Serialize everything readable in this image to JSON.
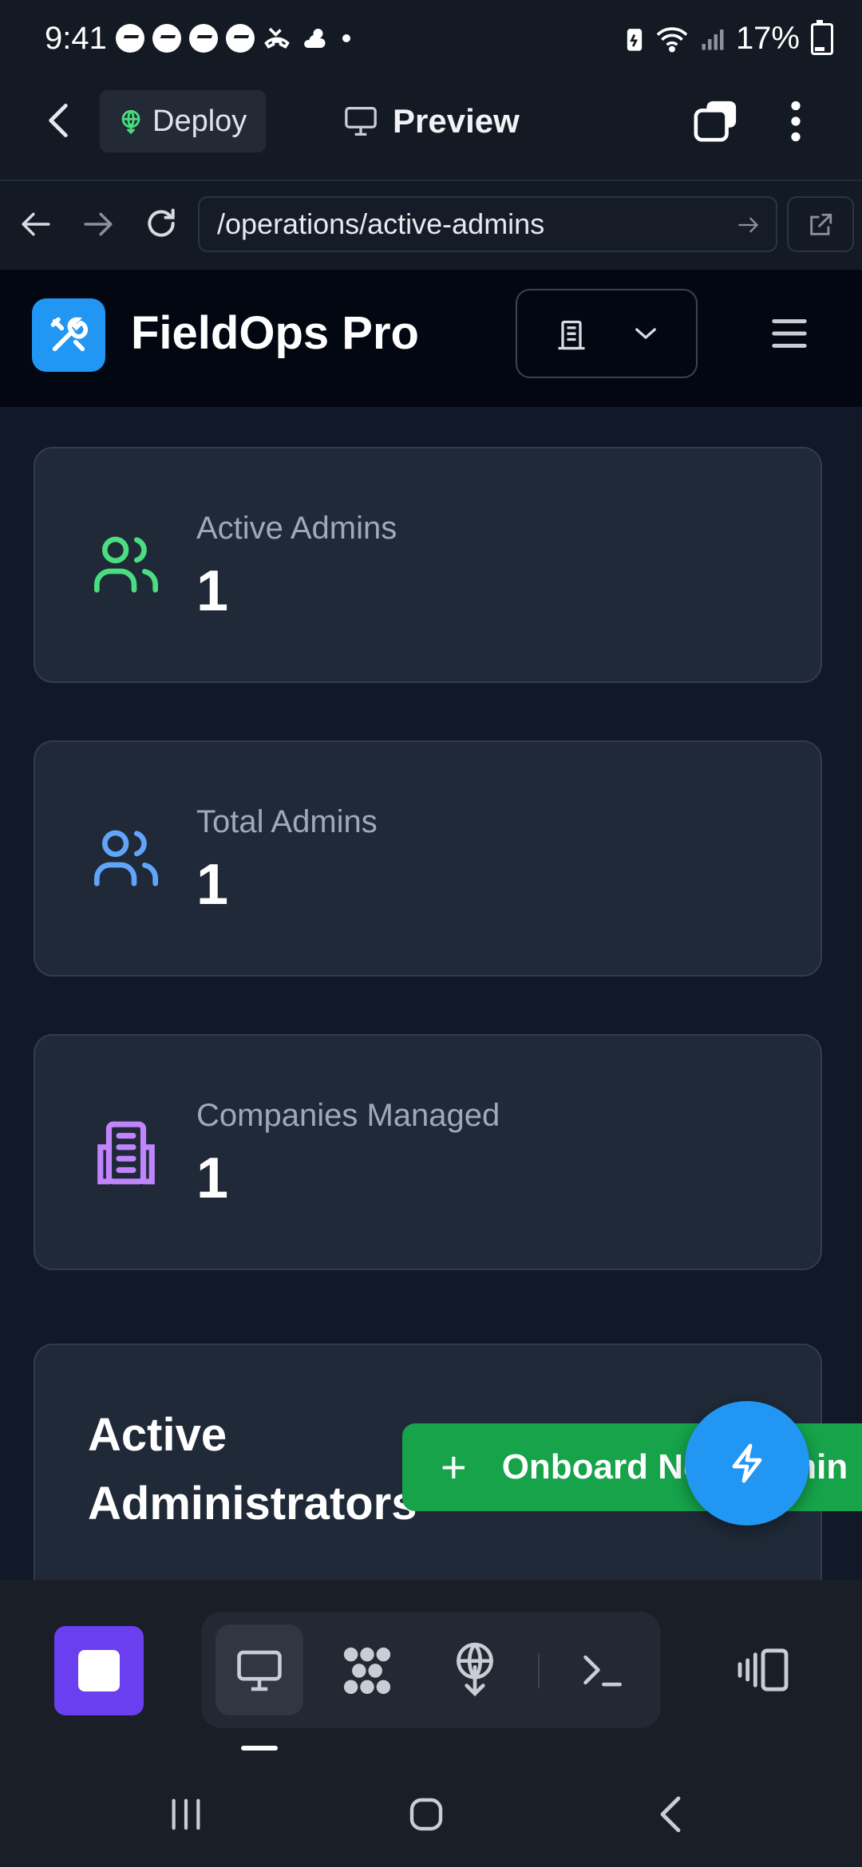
{
  "status_bar": {
    "time": "9:41",
    "battery": "17%"
  },
  "toolbar": {
    "deploy_label": "Deploy",
    "preview_label": "Preview"
  },
  "url_bar": {
    "url": "/operations/active-admins"
  },
  "site_header": {
    "title": "FieldOps Pro"
  },
  "stats": [
    {
      "label": "Active Admins",
      "value": "1",
      "icon": "users-icon",
      "color": "#4ade80"
    },
    {
      "label": "Total Admins",
      "value": "1",
      "icon": "users-icon",
      "color": "#60a5fa"
    },
    {
      "label": "Companies Managed",
      "value": "1",
      "icon": "building-icon",
      "color": "#c084fc"
    }
  ],
  "admins_section": {
    "title": "Active Administrators",
    "onboard_label": "Onboard New Admin"
  },
  "colors": {
    "accent": "#2196f3",
    "success": "#16a34a",
    "stop": "#6a3ff0"
  }
}
